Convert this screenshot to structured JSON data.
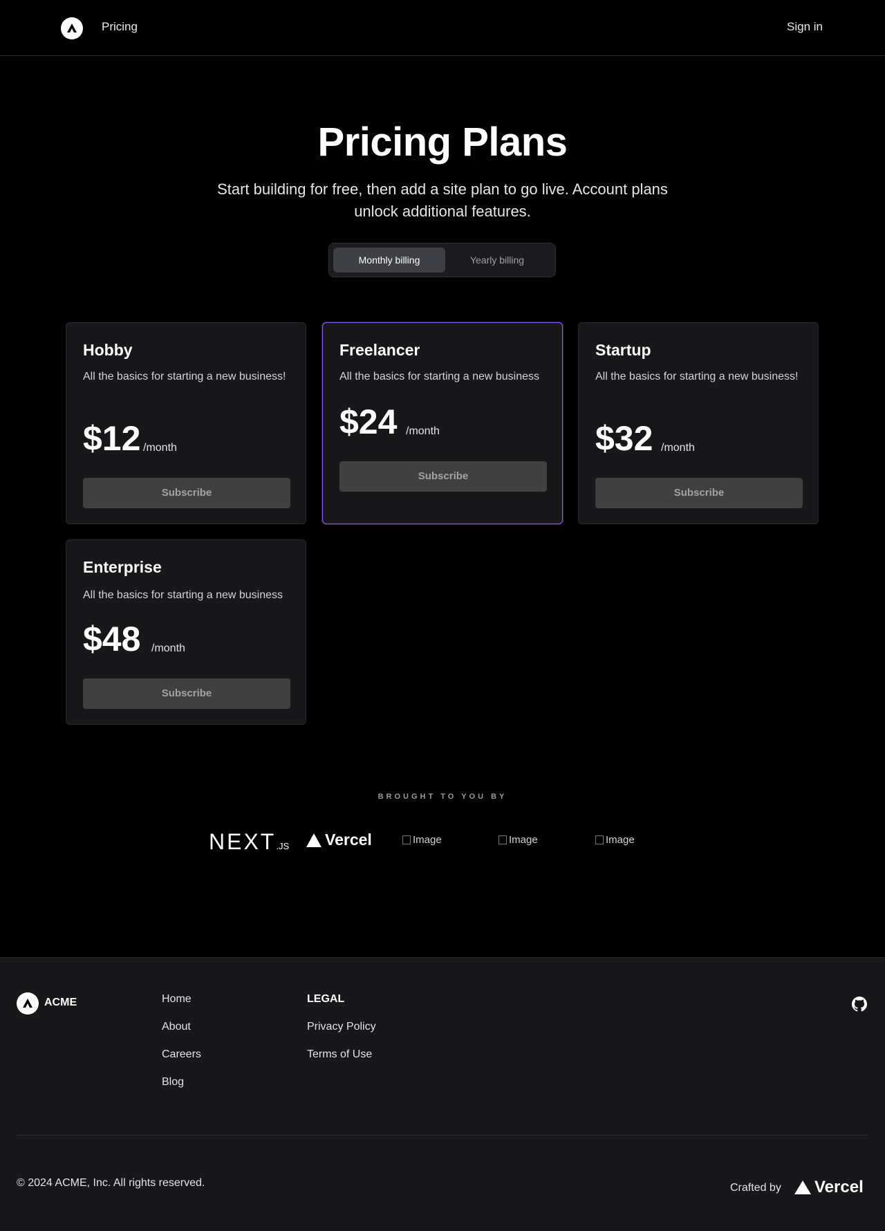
{
  "header": {
    "nav_pricing": "Pricing",
    "sign_in": "Sign in"
  },
  "hero": {
    "title": "Pricing Plans",
    "subtitle": "Start building for free, then add a site plan to go live. Account plans unlock additional features.",
    "billing_monthly": "Monthly billing",
    "billing_yearly": "Yearly billing",
    "selected_billing": "Monthly billing"
  },
  "plans": [
    {
      "name": "Hobby",
      "description": "All the basics for starting a new business!",
      "price": "$12",
      "period": "/month",
      "button": "Subscribe"
    },
    {
      "name": "Freelancer",
      "description": "All the basics for starting a new business",
      "price": "$24",
      "period": "/month",
      "button": "Subscribe"
    },
    {
      "name": "Startup",
      "description": "All the basics for starting a new business!",
      "price": "$32",
      "period": "/month",
      "button": "Subscribe"
    },
    {
      "name": "Enterprise",
      "description": "All the basics for starting a new business",
      "price": "$48",
      "period": "/month",
      "button": "Subscribe"
    }
  ],
  "sponsors": {
    "label": "BROUGHT TO YOU BY",
    "nextjs_main": "NEXT",
    "nextjs_suffix": ".JS",
    "vercel": "Vercel",
    "image_alt": "Image"
  },
  "footer": {
    "brand": "ACME",
    "links": [
      "Home",
      "About",
      "Careers",
      "Blog"
    ],
    "legal_heading": "LEGAL",
    "legal_links": [
      "Privacy Policy",
      "Terms of Use"
    ],
    "copyright": "© 2024 ACME, Inc. All rights reserved.",
    "crafted_by": "Crafted by",
    "vercel": "Vercel"
  },
  "colors": {
    "background": "#000000",
    "card": "#18181b",
    "featured_border": "#8b5cf6",
    "button": "#404040"
  }
}
